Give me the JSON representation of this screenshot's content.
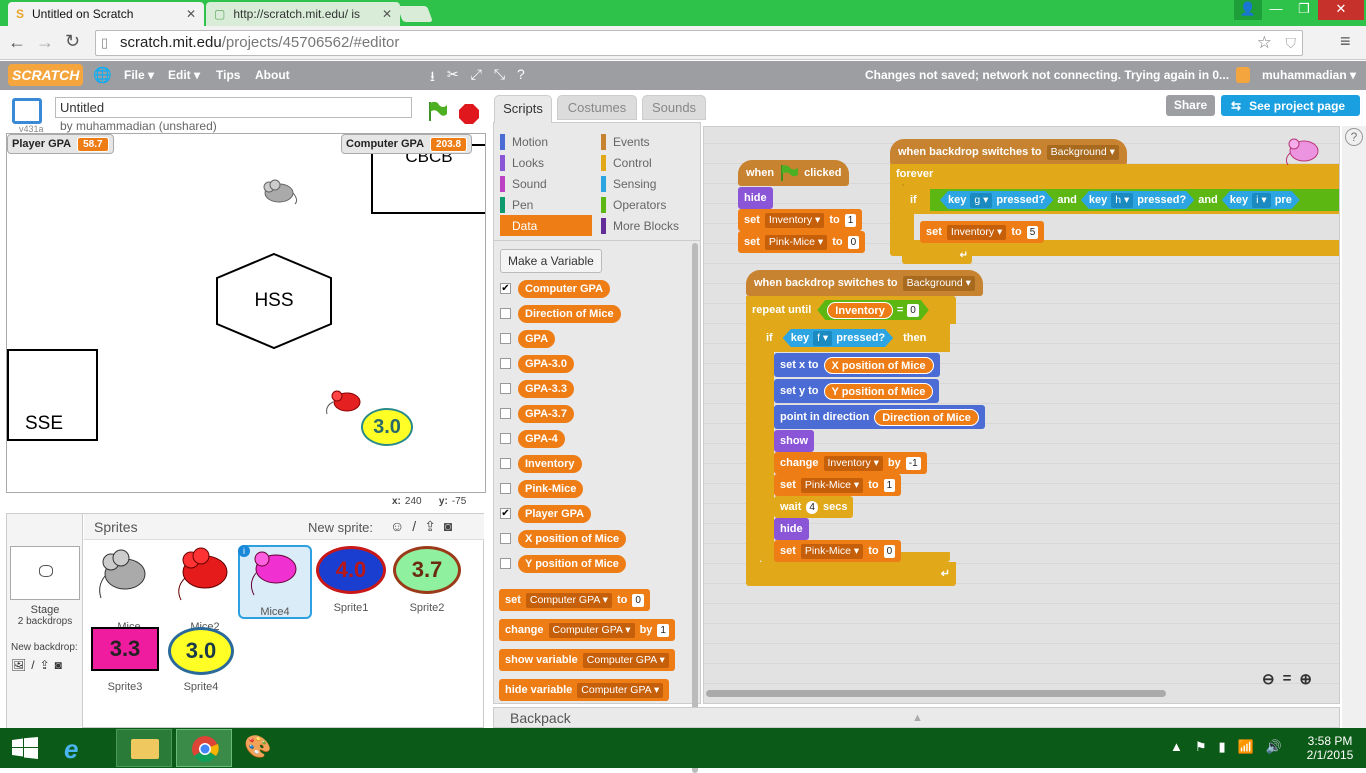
{
  "browser": {
    "tabs": [
      {
        "label": "Untitled on Scratch"
      },
      {
        "label": "http://scratch.mit.edu/ is"
      }
    ],
    "address": {
      "host": "scratch.mit.edu",
      "path": "/projects/45706562/#editor"
    },
    "win_close": "✕",
    "win_max": "❐",
    "win_min": "—"
  },
  "menu": {
    "logo": "SCRATCH",
    "items": [
      "File ▾",
      "Edit ▾",
      "Tips",
      "About"
    ],
    "status": "Changes not saved; network not connecting. Trying again in 0...",
    "user": "muhammadian ▾"
  },
  "project": {
    "title": "Untitled",
    "author": "by muhammadian (unshared)",
    "version": "v431a",
    "share": "Share",
    "see_project": "See project page"
  },
  "stage": {
    "monitors": [
      {
        "label": "Player GPA",
        "value": "58.7"
      },
      {
        "label": "Computer GPA",
        "value": "203.8"
      }
    ],
    "sprites": {
      "cbcb": "CBCB",
      "hss": "HSS",
      "sse": "SSE",
      "gpa": "3.0"
    },
    "coords": {
      "x_label": "x:",
      "x": "240",
      "y_label": "y:",
      "y": "-75"
    }
  },
  "sprite_pane": {
    "title": "Sprites",
    "new_sprite": "New sprite:",
    "stage_label": "Stage",
    "backdrops": "2 backdrops",
    "new_backdrop": "New backdrop:",
    "sprites": [
      {
        "name": "Mice",
        "selected": false
      },
      {
        "name": "Mice2",
        "selected": false
      },
      {
        "name": "Mice4",
        "selected": true
      },
      {
        "name": "Sprite1",
        "text": "4.0",
        "selected": false
      },
      {
        "name": "Sprite2",
        "text": "3.7",
        "selected": false
      },
      {
        "name": "Sprite3",
        "text": "3.3",
        "selected": false
      },
      {
        "name": "Sprite4",
        "text": "3.0",
        "selected": false
      }
    ]
  },
  "tabs": {
    "scripts": "Scripts",
    "costumes": "Costumes",
    "sounds": "Sounds"
  },
  "categories": [
    {
      "label": "Motion",
      "color": "#4a6cd4"
    },
    {
      "label": "Events",
      "color": "#c88330"
    },
    {
      "label": "Looks",
      "color": "#8a55d7"
    },
    {
      "label": "Control",
      "color": "#e1a91a"
    },
    {
      "label": "Sound",
      "color": "#bb42c3"
    },
    {
      "label": "Sensing",
      "color": "#2ca5e2"
    },
    {
      "label": "Pen",
      "color": "#0e9a6c"
    },
    {
      "label": "Operators",
      "color": "#5cb712"
    },
    {
      "label": "Data",
      "color": "#ee7d16"
    },
    {
      "label": "More Blocks",
      "color": "#632d99"
    }
  ],
  "palette": {
    "make_variable": "Make a Variable",
    "variables": [
      {
        "name": "Computer GPA",
        "checked": true
      },
      {
        "name": "Direction of Mice",
        "checked": false
      },
      {
        "name": "GPA",
        "checked": false
      },
      {
        "name": "GPA-3.0",
        "checked": false
      },
      {
        "name": "GPA-3.3",
        "checked": false
      },
      {
        "name": "GPA-3.7",
        "checked": false
      },
      {
        "name": "GPA-4",
        "checked": false
      },
      {
        "name": "Inventory",
        "checked": false
      },
      {
        "name": "Pink-Mice",
        "checked": false
      },
      {
        "name": "Player GPA",
        "checked": true
      },
      {
        "name": "X position of Mice",
        "checked": false
      },
      {
        "name": "Y position of Mice",
        "checked": false
      }
    ],
    "blocks": {
      "set": "set",
      "to": "to",
      "set_var": "Computer GPA",
      "set_val": "0",
      "change": "change",
      "by": "by",
      "change_var": "Computer GPA",
      "change_val": "1",
      "show_variable": "show variable",
      "show_var": "Computer GPA",
      "hide_variable": "hide variable",
      "hide_var": "Computer GPA"
    }
  },
  "script1": {
    "when": "when",
    "clicked": "clicked",
    "hide": "hide",
    "set": "set",
    "to": "to",
    "var1": "Inventory",
    "val1": "1",
    "var2": "Pink-Mice",
    "val2": "0"
  },
  "script2": {
    "hat": "when backdrop switches to",
    "backdrop": "Background",
    "forever": "forever",
    "if": "if",
    "key": "key",
    "pressed": "pressed?",
    "and": "and",
    "k1": "g",
    "k2": "h",
    "k3": "i",
    "pre": "pre",
    "set": "set",
    "to": "to",
    "var": "Inventory",
    "val": "5"
  },
  "script3": {
    "hat": "when backdrop switches to",
    "backdrop": "Background",
    "repeat_until": "repeat until",
    "inventory": "Inventory",
    "eq": "=",
    "zero": "0",
    "if": "if",
    "then": "then",
    "key": "key",
    "kf": "f",
    "pressed": "pressed?",
    "set_x": "set x to",
    "x_var": "X position of Mice",
    "set_y": "set y to",
    "y_var": "Y position of Mice",
    "point": "point in direction",
    "dir_var": "Direction of Mice",
    "show": "show",
    "change": "change",
    "change_var": "Inventory",
    "by": "by",
    "change_val": "-1",
    "set": "set",
    "to": "to",
    "pm": "Pink-Mice",
    "one": "1",
    "wait": "wait",
    "secs": "secs",
    "wait_val": "4",
    "hide": "hide",
    "zero2": "0"
  },
  "backpack": "Backpack",
  "taskbar": {
    "time": "3:58 PM",
    "date": "2/1/2015"
  }
}
